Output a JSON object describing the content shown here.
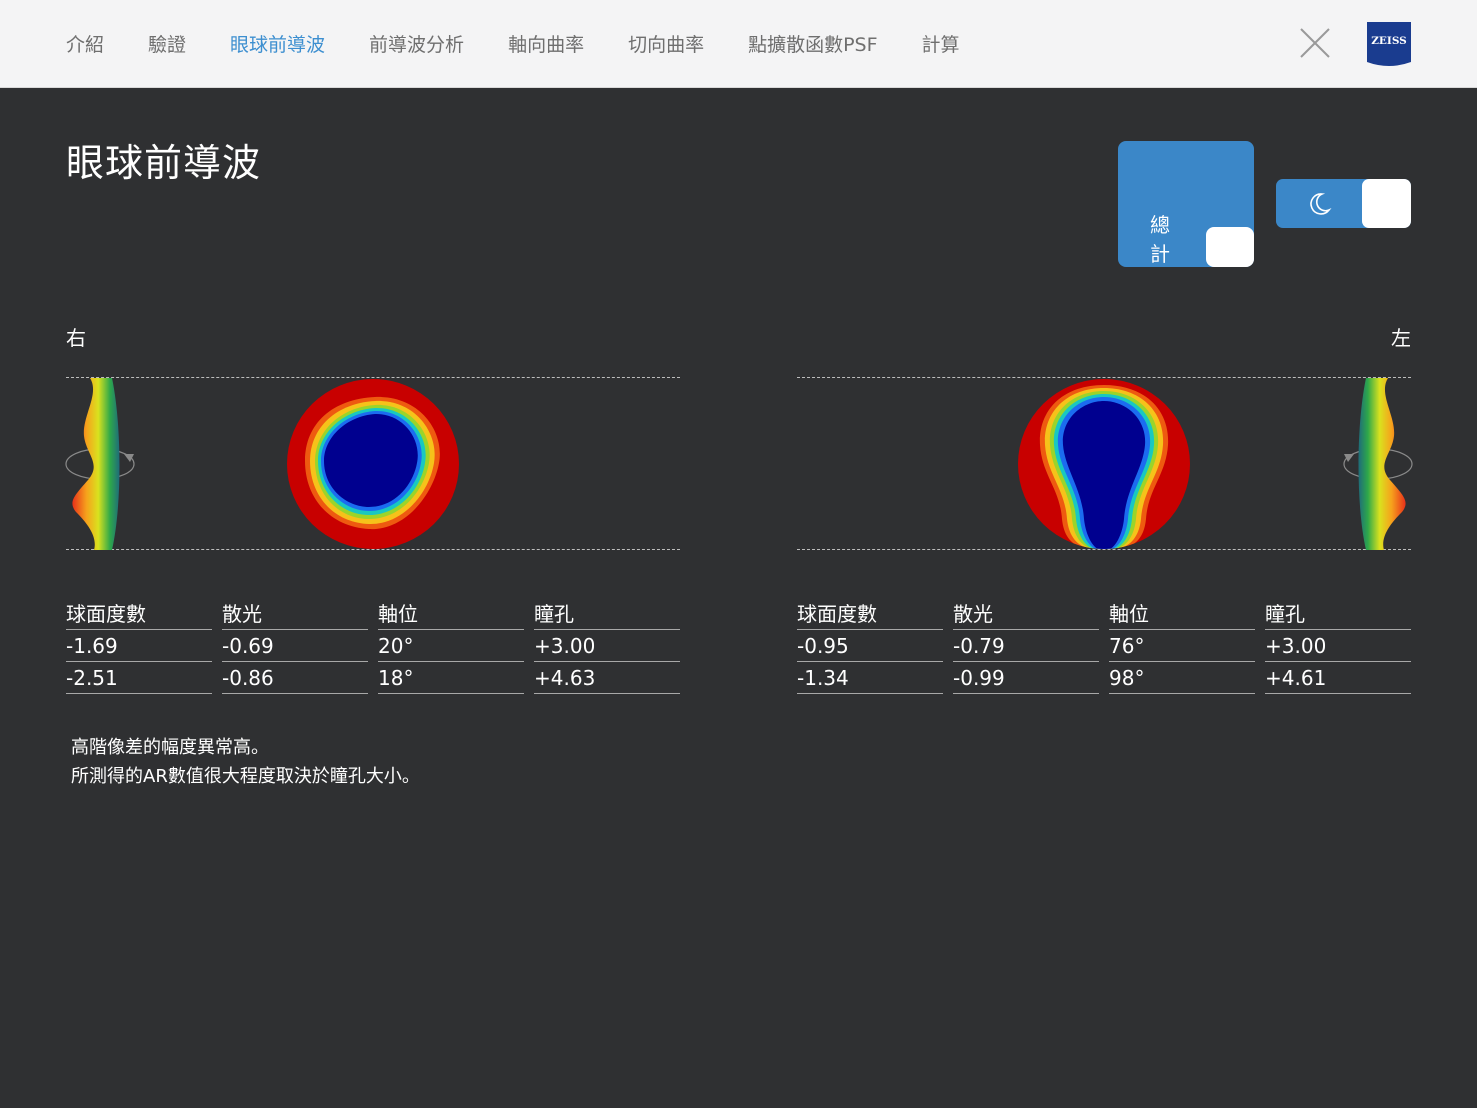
{
  "nav": {
    "items": [
      "介紹",
      "驗證",
      "眼球前導波",
      "前導波分析",
      "軸向曲率",
      "切向曲率",
      "點擴散函數PSF",
      "計算"
    ],
    "active_index": 2,
    "close_icon": "close-icon",
    "logo_text": "ZEISS"
  },
  "page": {
    "title": "眼球前導波"
  },
  "controls": {
    "total_toggle_label": "總計",
    "night_toggle_icon": "moon-icon"
  },
  "eyes": {
    "right": {
      "label": "右",
      "table": {
        "headers": [
          "球面度數",
          "散光",
          "軸位",
          "瞳孔"
        ],
        "rows": [
          [
            "-1.69",
            "-0.69",
            "20°",
            "+3.00"
          ],
          [
            "-2.51",
            "-0.86",
            "18°",
            "+4.63"
          ]
        ]
      }
    },
    "left": {
      "label": "左",
      "table": {
        "headers": [
          "球面度數",
          "散光",
          "軸位",
          "瞳孔"
        ],
        "rows": [
          [
            "-0.95",
            "-0.79",
            "76°",
            "+3.00"
          ],
          [
            "-1.34",
            "-0.99",
            "98°",
            "+4.61"
          ]
        ]
      }
    }
  },
  "notes": {
    "line1": "高階像差的幅度異常高。",
    "line2": "所測得的AR數值很大程度取決於瞳孔大小。"
  },
  "colors": {
    "accent": "#3b87c8",
    "nav_active": "#3d8fd0",
    "background": "#2f3032",
    "topbar": "#f4f4f5",
    "map_outer": "#c80000",
    "map_center": "#00008f"
  }
}
